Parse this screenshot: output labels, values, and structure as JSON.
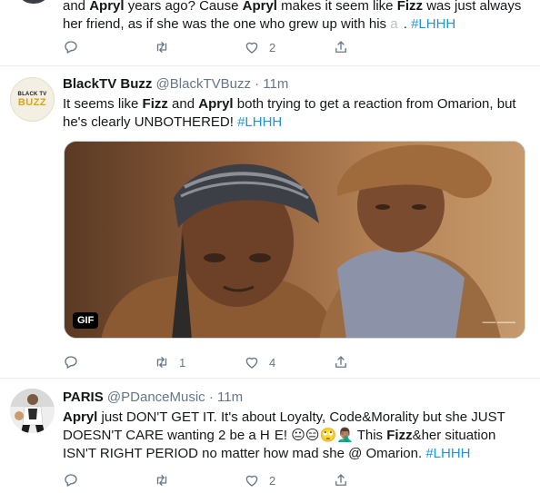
{
  "tweets": [
    {
      "segments": [
        {
          "text": "and ",
          "bold": false
        },
        {
          "text": "Apryl",
          "bold": true
        },
        {
          "text": " years ago? Cause ",
          "bold": false
        },
        {
          "text": "Apryl",
          "bold": true
        },
        {
          "text": " makes it seem like ",
          "bold": false
        },
        {
          "text": "Fizz",
          "bold": true
        },
        {
          "text": " was just always her friend, as if she was the one who grew up with his ",
          "bold": false
        },
        {
          "text": "a  ",
          "faded": true
        },
        {
          "text": ". ",
          "bold": false
        },
        {
          "text": "#LHHH",
          "hashtag": true
        }
      ],
      "actions": {
        "reply_count": "",
        "retweet_count": "",
        "like_count": "2"
      }
    },
    {
      "name": "BlackTV Buzz",
      "handle": "@BlackTVBuzz",
      "separator": "·",
      "time": "11m",
      "avatar_line1": "BLACK TV",
      "avatar_line2": "BUZZ",
      "segments": [
        {
          "text": "It seems like ",
          "bold": false
        },
        {
          "text": "Fizz",
          "bold": true
        },
        {
          "text": " and ",
          "bold": false
        },
        {
          "text": "Apryl",
          "bold": true
        },
        {
          "text": " both trying to get a reaction from Omarion, but he's clearly UNBOTHERED! ",
          "bold": false
        },
        {
          "text": "#LHHH",
          "hashtag": true
        }
      ],
      "media": {
        "badge": "GIF"
      },
      "actions": {
        "reply_count": "",
        "retweet_count": "1",
        "like_count": "4"
      }
    },
    {
      "name": "PARIS",
      "handle": "@PDanceMusic",
      "separator": "·",
      "time": "11m",
      "segments": [
        {
          "text": "Apryl",
          "bold": true
        },
        {
          "text": " just DON'T GET IT. It's about Loyalty, Code&Morality but she JUST DOESN'T CARE wanting 2 be a H",
          "bold": false
        },
        {
          "text": "   ",
          "faded": true
        },
        {
          "text": "E! 😐😑🙄🤦🏽‍♂️ This ",
          "bold": false
        },
        {
          "text": "Fizz",
          "bold": true
        },
        {
          "text": "&her situation ISN'T  RIGHT PERIOD no matter how mad she @ Omarion. ",
          "bold": false
        },
        {
          "text": "#LHHH",
          "hashtag": true
        }
      ],
      "actions": {
        "reply_count": "",
        "retweet_count": "",
        "like_count": "2"
      }
    }
  ]
}
